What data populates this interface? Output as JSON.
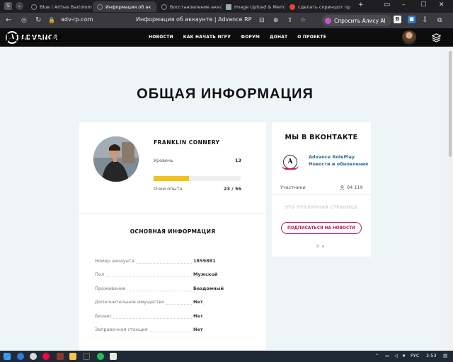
{
  "browser": {
    "tabs": [
      {
        "label": "Blue | Arthas Bartolom",
        "active": false
      },
      {
        "label": "Информация об ак",
        "active": true
      },
      {
        "label": "Восстановление акка",
        "active": false
      },
      {
        "label": "Image Upload & Meme",
        "active": false
      },
      {
        "label": "сделать скриншот пр",
        "active": false
      }
    ],
    "url": "adv-rp.com",
    "page_title": "Информация об аккаунте | Advance RP",
    "alice_label": "Спросить Алису AI"
  },
  "site": {
    "logo_text": "ADVANCE",
    "logo_letter": "A",
    "logo_sub": "ROLEPLAY",
    "nav": [
      "НОВОСТИ",
      "КАК НАЧАТЬ ИГРУ",
      "ФОРУМ",
      "ДОНАТ",
      "О ПРОЕКТЕ"
    ]
  },
  "page": {
    "heading": "ОБЩАЯ ИНФОРМАЦИЯ",
    "player": {
      "name": "FRANKLIN CONNERY",
      "level_label": "Уровень",
      "level": "13",
      "xp_label": "Очки опыта",
      "xp": "23 / 56",
      "xp_fraction": 0.41
    },
    "basic_info_title": "ОСНОВНАЯ ИНФОРМАЦИЯ",
    "info": [
      {
        "key": "Номер аккаунта",
        "value": "1859881"
      },
      {
        "key": "Пол",
        "value": "Мужской"
      },
      {
        "key": "Проживание",
        "value": "Бездомный"
      },
      {
        "key": "Дополнительное имущество",
        "value": "Нет"
      },
      {
        "key": "Бизнес",
        "value": "Нет"
      },
      {
        "key": "Заправочная станция",
        "value": "Нет"
      }
    ]
  },
  "vk": {
    "title": "МЫ В ВКОНТАКТЕ",
    "group_letter": "A",
    "group_name": "Advance RolePlay",
    "group_sub": "Новости и обновления",
    "members_label": "Участники",
    "members_count": "64 119",
    "public_note": "ЭТО ПУБЛИЧНАЯ СТРАНИЦА",
    "subscribe_label": "ПОДПИСАТЬСЯ НА НОВОСТИ"
  },
  "taskbar": {
    "lang": "РУС",
    "time": "2:53"
  },
  "colors": {
    "accent": "#c2185b",
    "progress": "#f2c31a",
    "link": "#2d6a8f",
    "page_bg": "#eef5f6"
  }
}
